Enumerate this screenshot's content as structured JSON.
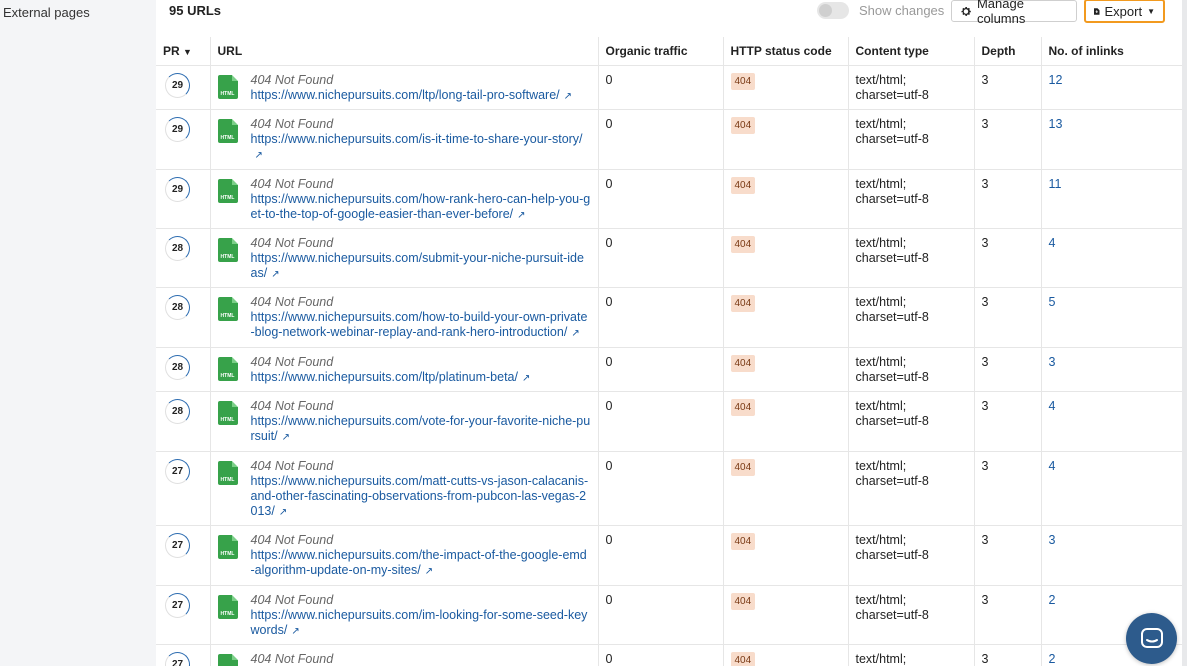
{
  "sidebar": {
    "external_pages": "External pages"
  },
  "toolbar": {
    "url_count": "95 URLs",
    "show_changes": "Show changes",
    "manage_columns": "Manage columns",
    "export": "Export"
  },
  "table": {
    "columns": [
      "PR",
      "URL",
      "Organic traffic",
      "HTTP status code",
      "Content type",
      "Depth",
      "No. of inlinks"
    ],
    "rows": [
      {
        "pr": "29",
        "title": "404 Not Found",
        "url": "https://www.nichepursuits.com/ltp/long-tail-pro-software/",
        "traffic": "0",
        "status": "404",
        "ctype": "text/html; charset=utf-8",
        "depth": "3",
        "inlinks": "12"
      },
      {
        "pr": "29",
        "title": "404 Not Found",
        "url": "https://www.nichepursuits.com/is-it-time-to-share-your-story/",
        "traffic": "0",
        "status": "404",
        "ctype": "text/html; charset=utf-8",
        "depth": "3",
        "inlinks": "13"
      },
      {
        "pr": "29",
        "title": "404 Not Found",
        "url": "https://www.nichepursuits.com/how-rank-hero-can-help-you-get-to-the-top-of-google-easier-than-ever-before/",
        "traffic": "0",
        "status": "404",
        "ctype": "text/html; charset=utf-8",
        "depth": "3",
        "inlinks": "11"
      },
      {
        "pr": "28",
        "title": "404 Not Found",
        "url": "https://www.nichepursuits.com/submit-your-niche-pursuit-ideas/",
        "traffic": "0",
        "status": "404",
        "ctype": "text/html; charset=utf-8",
        "depth": "3",
        "inlinks": "4"
      },
      {
        "pr": "28",
        "title": "404 Not Found",
        "url": "https://www.nichepursuits.com/how-to-build-your-own-private-blog-network-webinar-replay-and-rank-hero-introduction/",
        "traffic": "0",
        "status": "404",
        "ctype": "text/html; charset=utf-8",
        "depth": "3",
        "inlinks": "5"
      },
      {
        "pr": "28",
        "title": "404 Not Found",
        "url": "https://www.nichepursuits.com/ltp/platinum-beta/",
        "traffic": "0",
        "status": "404",
        "ctype": "text/html; charset=utf-8",
        "depth": "3",
        "inlinks": "3"
      },
      {
        "pr": "28",
        "title": "404 Not Found",
        "url": "https://www.nichepursuits.com/vote-for-your-favorite-niche-pursuit/",
        "traffic": "0",
        "status": "404",
        "ctype": "text/html; charset=utf-8",
        "depth": "3",
        "inlinks": "4"
      },
      {
        "pr": "27",
        "title": "404 Not Found",
        "url": "https://www.nichepursuits.com/matt-cutts-vs-jason-calacanis-and-other-fascinating-observations-from-pubcon-las-vegas-2013/",
        "traffic": "0",
        "status": "404",
        "ctype": "text/html; charset=utf-8",
        "depth": "3",
        "inlinks": "4"
      },
      {
        "pr": "27",
        "title": "404 Not Found",
        "url": "https://www.nichepursuits.com/the-impact-of-the-google-emd-algorithm-update-on-my-sites/",
        "traffic": "0",
        "status": "404",
        "ctype": "text/html; charset=utf-8",
        "depth": "3",
        "inlinks": "3"
      },
      {
        "pr": "27",
        "title": "404 Not Found",
        "url": "https://www.nichepursuits.com/im-looking-for-some-seed-keywords/",
        "traffic": "0",
        "status": "404",
        "ctype": "text/html; charset=utf-8",
        "depth": "3",
        "inlinks": "2"
      },
      {
        "pr": "27",
        "title": "404 Not Found",
        "url": "",
        "traffic": "0",
        "status": "404",
        "ctype": "text/html;",
        "depth": "3",
        "inlinks": "2"
      }
    ]
  }
}
